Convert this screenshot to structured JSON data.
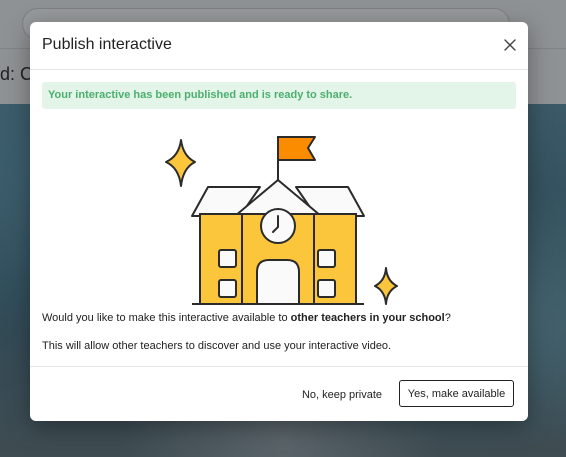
{
  "background": {
    "partial_text": "d: C"
  },
  "modal": {
    "title": "Publish interactive",
    "close_icon": "close-icon",
    "alert_text": "Your interactive has been published and is ready to share.",
    "question_prefix": "Would you like to make this interactive available to ",
    "question_bold": "other teachers in your school",
    "question_suffix": "?",
    "info_text": "This will allow other teachers to discover and use your interactive video.",
    "secondary_button": "No, keep private",
    "primary_button": "Yes, make available"
  },
  "colors": {
    "alert_bg": "#e3f4e8",
    "alert_text": "#4caf6e",
    "school_yellow": "#fcc63c",
    "flag_orange": "#fb8c00",
    "outline": "#2b2b2b"
  }
}
